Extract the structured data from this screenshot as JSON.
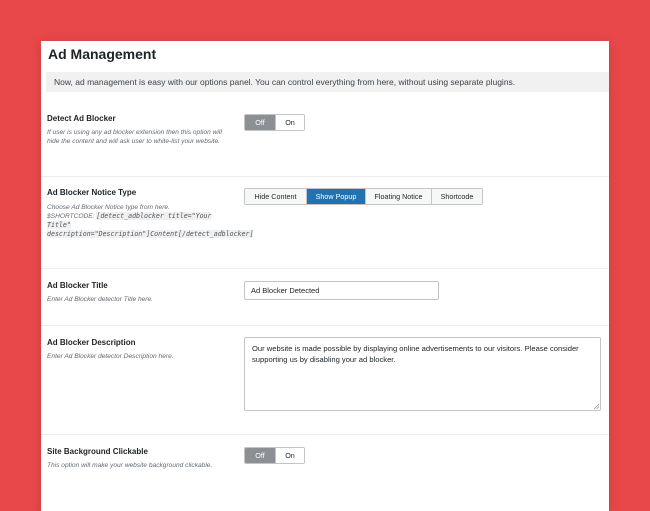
{
  "panel": {
    "title": "Ad Management",
    "notice": "Now, ad management is easy with our options panel. You can control everything from here, without using separate plugins."
  },
  "detect_ad_blocker": {
    "label": "Detect Ad Blocker",
    "description": "If user is using any ad blocker extension then this option will hide the content and will ask user to white-list your website.",
    "options": [
      "Off",
      "On"
    ],
    "selected": "Off"
  },
  "notice_type": {
    "label": "Ad Blocker Notice Type",
    "description_line1": "Choose Ad Blocker Notice type from here.",
    "description_prefix": "$SHORTCODE:",
    "shortcode": "[detect_adblocker title=\"Your Title\" description=\"Description\"]Content[/detect_adblocker]",
    "options": [
      "Hide Content",
      "Show Popup",
      "Floating Notice",
      "Shortcode"
    ],
    "selected": "Show Popup"
  },
  "ad_blocker_title": {
    "label": "Ad Blocker Title",
    "description": "Enter Ad Blocker detector Title here.",
    "value": "Ad Blocker Detected"
  },
  "ad_blocker_description": {
    "label": "Ad Blocker Description",
    "description": "Enter Ad Blocker detector Description here.",
    "value": "Our website is made possible by displaying online advertisements to our visitors. Please consider supporting us by disabling your ad blocker."
  },
  "background_clickable": {
    "label": "Site Background Clickable",
    "description": "This option will make your website background clickable.",
    "options": [
      "Off",
      "On"
    ],
    "selected": "Off"
  },
  "colors": {
    "background": "#e8484a",
    "accent": "#2271b1",
    "toggle_active": "#8c8f94"
  }
}
